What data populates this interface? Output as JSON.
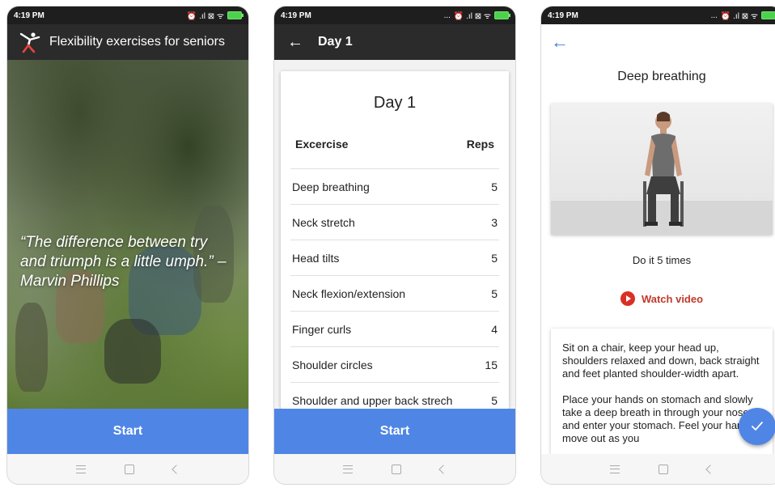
{
  "status_bar": {
    "time": "4:19 PM",
    "icons_left": "⏰ .ıl ⊠ ᯤ",
    "icons_more": "..."
  },
  "screen1": {
    "app_title": "Flexibility exercises for seniors",
    "quote": "“The difference between try and triumph is a little umph.” – Marvin Phillips",
    "start_label": "Start",
    "logo_icon": "stretching-figure-icon"
  },
  "screen2": {
    "appbar_title": "Day 1",
    "card_title": "Day 1",
    "col_exercise": "Excercise",
    "col_reps": "Reps",
    "rows": [
      {
        "name": "Deep breathing",
        "reps": "5"
      },
      {
        "name": "Neck stretch",
        "reps": "3"
      },
      {
        "name": "Head tilts",
        "reps": "5"
      },
      {
        "name": "Neck flexion/extension",
        "reps": "5"
      },
      {
        "name": "Finger curls",
        "reps": "4"
      },
      {
        "name": "Shoulder circles",
        "reps": "15"
      },
      {
        "name": "Shoulder and upper back strech",
        "reps": "5"
      }
    ],
    "start_label": "Start"
  },
  "screen3": {
    "title": "Deep breathing",
    "do_times": "Do it 5 times",
    "watch_label": "Watch video",
    "instructions_p1": "Sit on a chair, keep your head up, shoulders relaxed and down, back straight and feet planted shoulder-width apart.",
    "instructions_p2": "Place your hands on stomach and slowly take a deep breath in through your nose and enter your stomach. Feel your hands move out as you"
  },
  "colors": {
    "accent": "#4f86e5",
    "appbar": "#2b2b2b",
    "youtube_red": "#d93025"
  }
}
